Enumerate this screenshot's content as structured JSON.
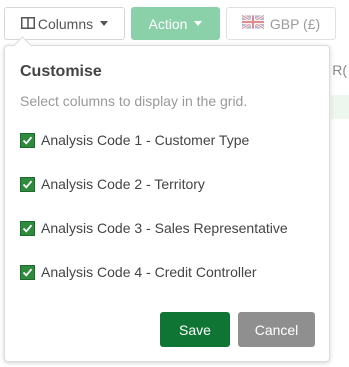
{
  "toolbar": {
    "columns_label": "Columns",
    "action_label": "Action",
    "currency_label": "GBP (£)"
  },
  "background": {
    "partial_header_text": "R("
  },
  "popover": {
    "title": "Customise",
    "description": "Select columns to display in the grid.",
    "options": [
      {
        "label": "Analysis Code 1 - Customer Type",
        "checked": true
      },
      {
        "label": "Analysis Code 2 - Territory",
        "checked": true
      },
      {
        "label": "Analysis Code 3 - Sales Representative",
        "checked": true
      },
      {
        "label": "Analysis Code 4 - Credit Controller",
        "checked": true
      }
    ],
    "save_label": "Save",
    "cancel_label": "Cancel"
  },
  "colors": {
    "action_button": "#8ad1a9",
    "save_button": "#0f7534",
    "cancel_button": "#8f8f8f",
    "checkbox_checked": "#2e8b3e"
  },
  "icons": {
    "columns": "columns-icon",
    "flag": "uk-flag-icon",
    "check": "check-icon",
    "caret": "caret-down-icon"
  }
}
